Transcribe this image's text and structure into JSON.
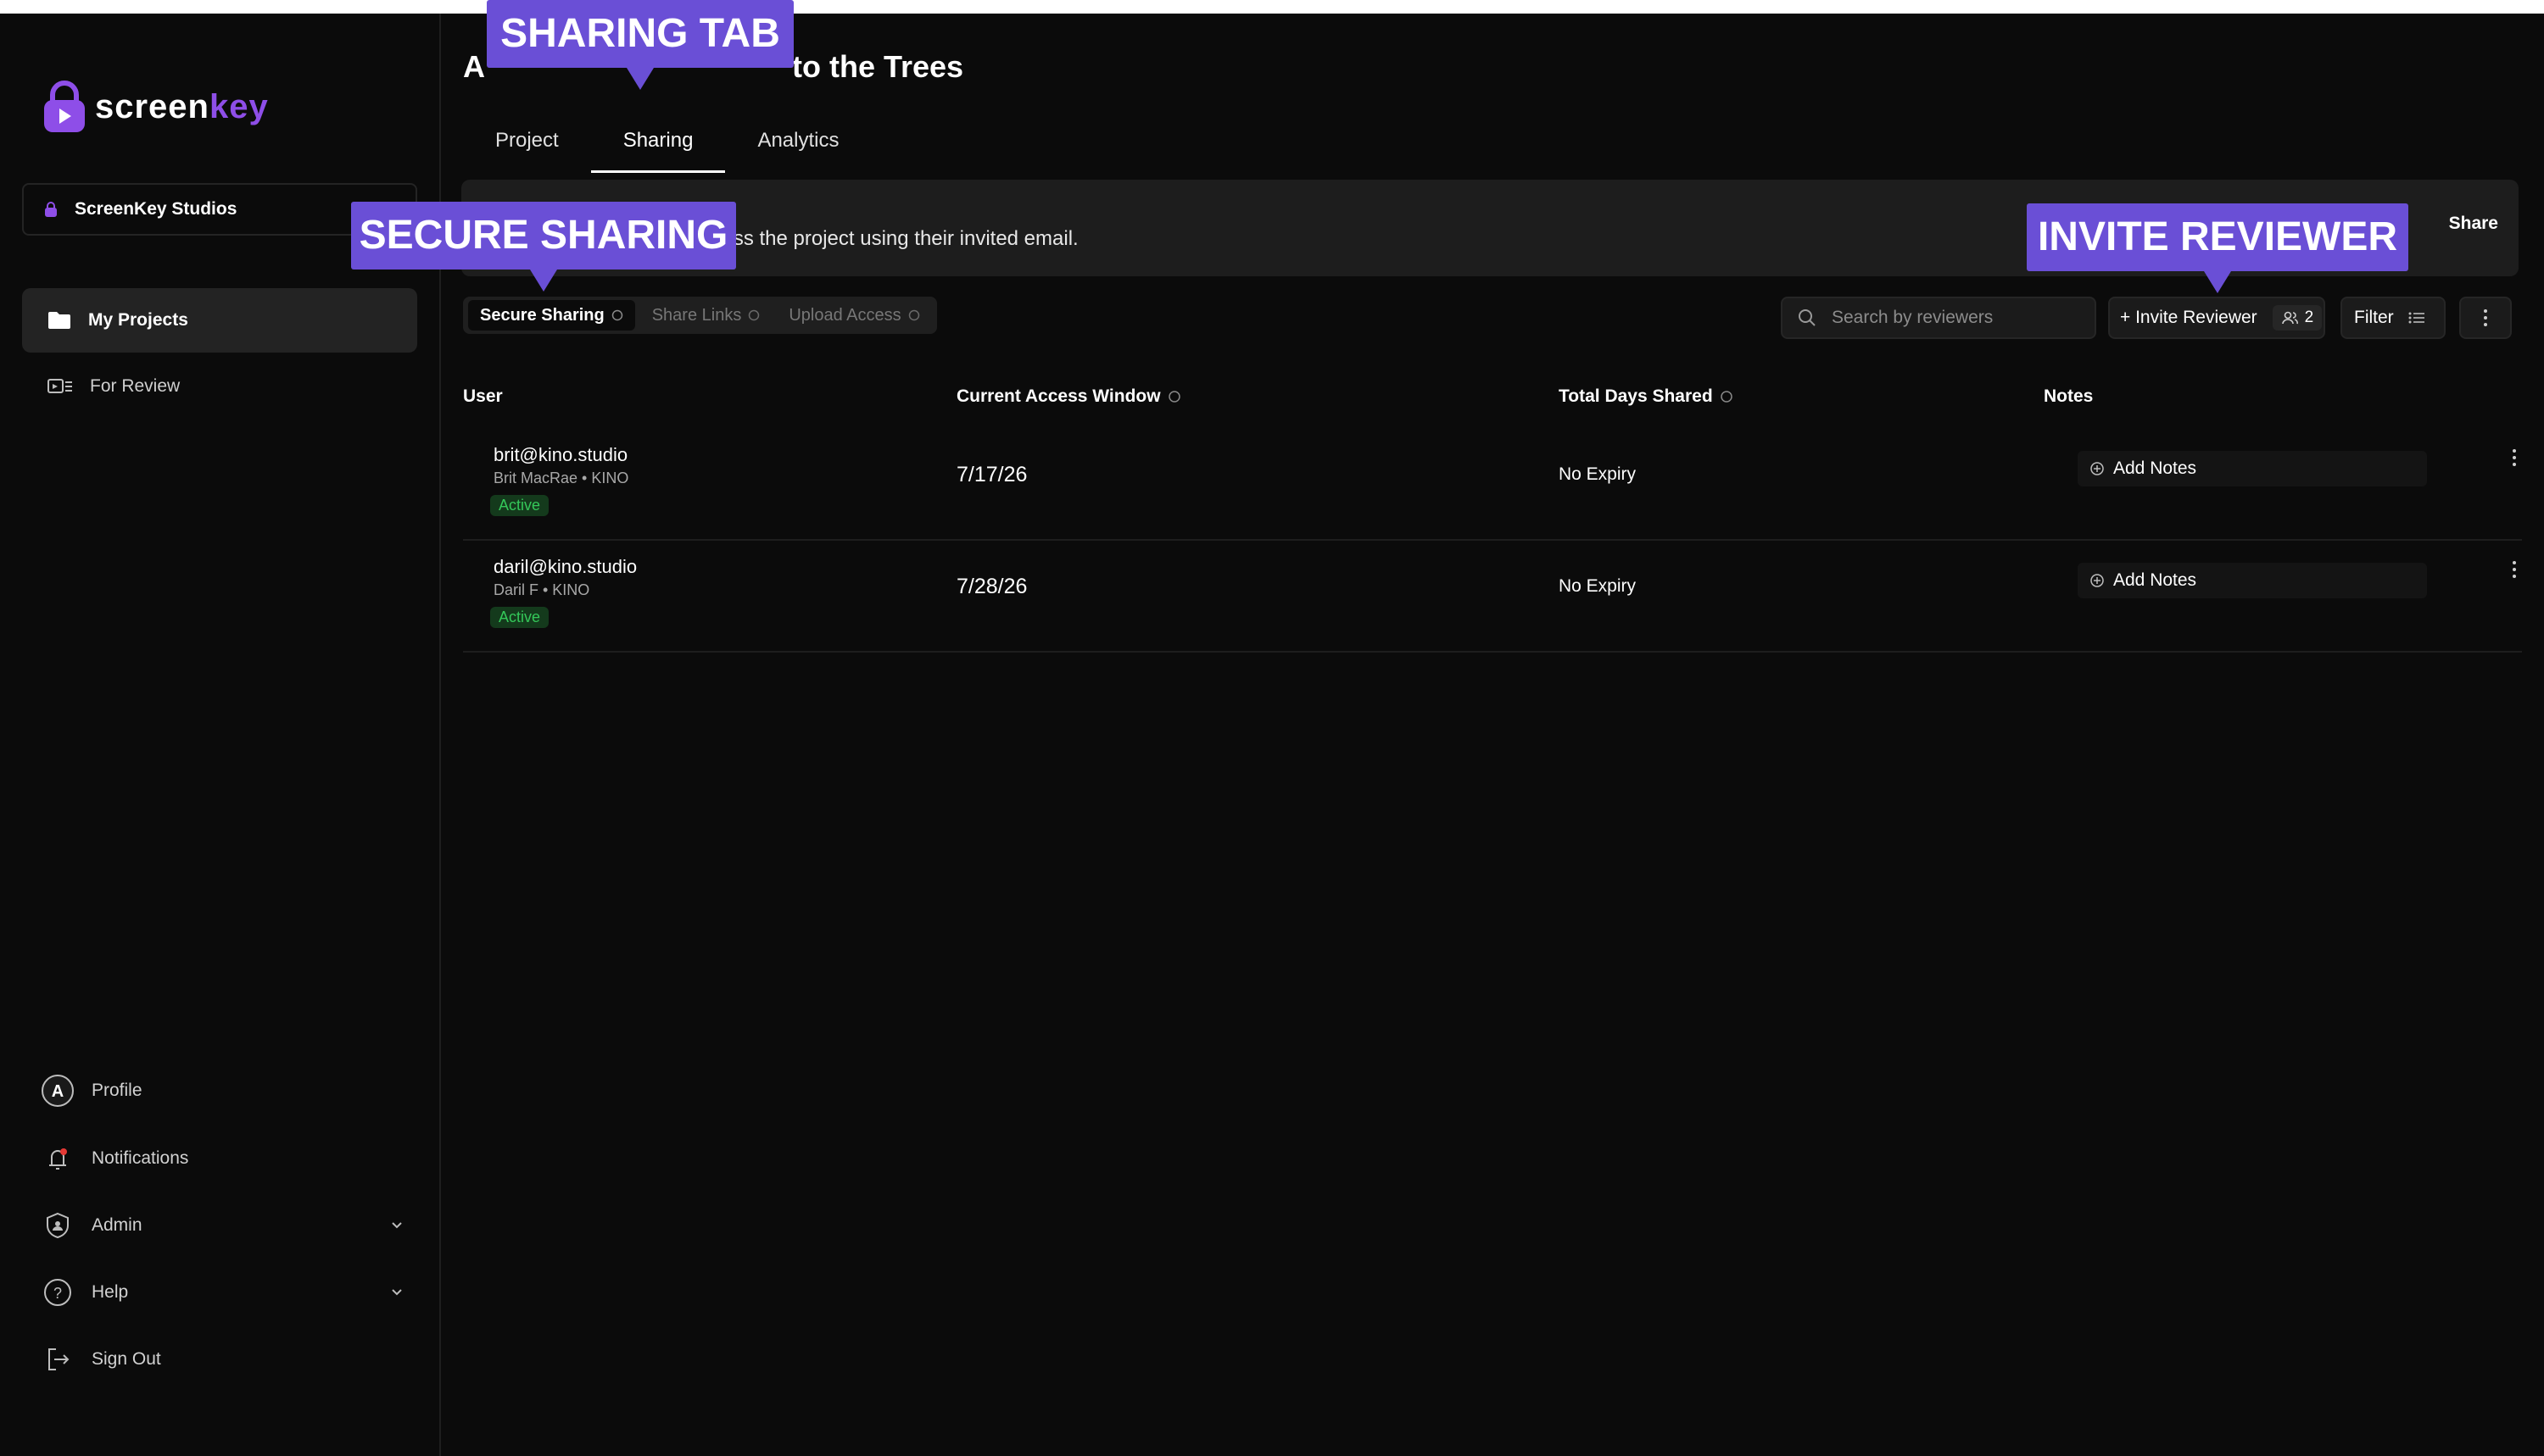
{
  "app": {
    "logo_text_a": "screen",
    "logo_text_b": "key",
    "brand_color": "#8e4ee8",
    "callout_color": "#6a4fd6"
  },
  "sidebar": {
    "org_name": "ScreenKey Studios",
    "nav": [
      {
        "label": "My Projects",
        "icon": "folder-icon",
        "active": true
      },
      {
        "label": "For Review",
        "icon": "review-icon",
        "active": false
      }
    ],
    "avatar_letter": "A",
    "bottom": [
      {
        "label": "Profile",
        "icon": "avatar-icon"
      },
      {
        "label": "Notifications",
        "icon": "bell-icon"
      },
      {
        "label": "Admin",
        "icon": "shield-icon"
      },
      {
        "label": "Help",
        "icon": "help-icon"
      },
      {
        "label": "Sign Out",
        "icon": "sign-out-icon"
      }
    ]
  },
  "main": {
    "title_visible": "A",
    "title_visible_end": "to the Trees",
    "tabs": [
      {
        "label": "Project",
        "active": false
      },
      {
        "label": "Sharing",
        "active": true
      },
      {
        "label": "Analytics",
        "active": false
      }
    ],
    "banner": {
      "text": "ted can use this link to access the project using their invited email.",
      "share_label": "Share"
    },
    "subtabs": [
      {
        "label": "Secure Sharing",
        "active": true
      },
      {
        "label": "Share Links",
        "active": false
      },
      {
        "label": "Upload Access",
        "active": false
      }
    ],
    "search_placeholder": "Search by reviewers",
    "invite_label": "+ Invite Reviewer",
    "reviewer_count": "2",
    "filter_label": "Filter",
    "columns": {
      "user": "User",
      "window": "Current Access Window",
      "days": "Total Days Shared",
      "notes": "Notes"
    },
    "rows": [
      {
        "email": "brit@kino.studio",
        "name": "Brit MacRae • KINO",
        "status": "Active",
        "window": "7/17/26",
        "days": "No Expiry",
        "notes": "Add Notes"
      },
      {
        "email": "daril@kino.studio",
        "name": "Daril F • KINO",
        "status": "Active",
        "window": "7/28/26",
        "days": "No Expiry",
        "notes": "Add Notes"
      }
    ]
  },
  "callouts": {
    "sharing_tab": "SHARING TAB",
    "secure_sharing": "SECURE SHARING",
    "invite_reviewer": "INVITE REVIEWER"
  }
}
